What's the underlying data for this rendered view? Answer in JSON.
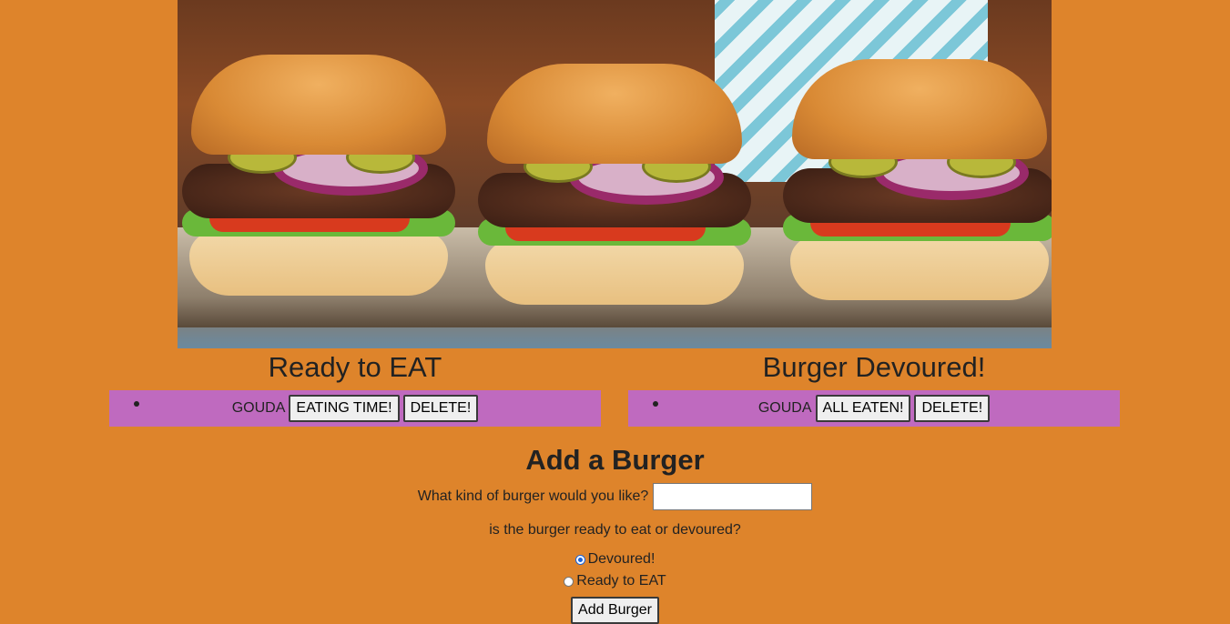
{
  "hero": {
    "icon": "burger-photo"
  },
  "columns": {
    "ready": {
      "title": "Ready to EAT",
      "items": [
        {
          "name": "GOUDA",
          "action_label": "EATING TIME!",
          "delete_label": "DELETE!"
        }
      ]
    },
    "devoured": {
      "title": "Burger Devoured!",
      "items": [
        {
          "name": "GOUDA",
          "action_label": "ALL EATEN!",
          "delete_label": "DELETE!"
        }
      ]
    }
  },
  "form": {
    "title": "Add a Burger",
    "question": "What kind of burger would you like?",
    "input_value": "",
    "status_question": "is the burger ready to eat or devoured?",
    "options": [
      {
        "label": "Devoured!",
        "checked": true
      },
      {
        "label": "Ready to EAT",
        "checked": false
      }
    ],
    "submit_label": "Add Burger"
  },
  "colors": {
    "page_bg": "#DE842B",
    "list_bg": "#BF6ABF",
    "radio_accent": "#1a63d8"
  }
}
